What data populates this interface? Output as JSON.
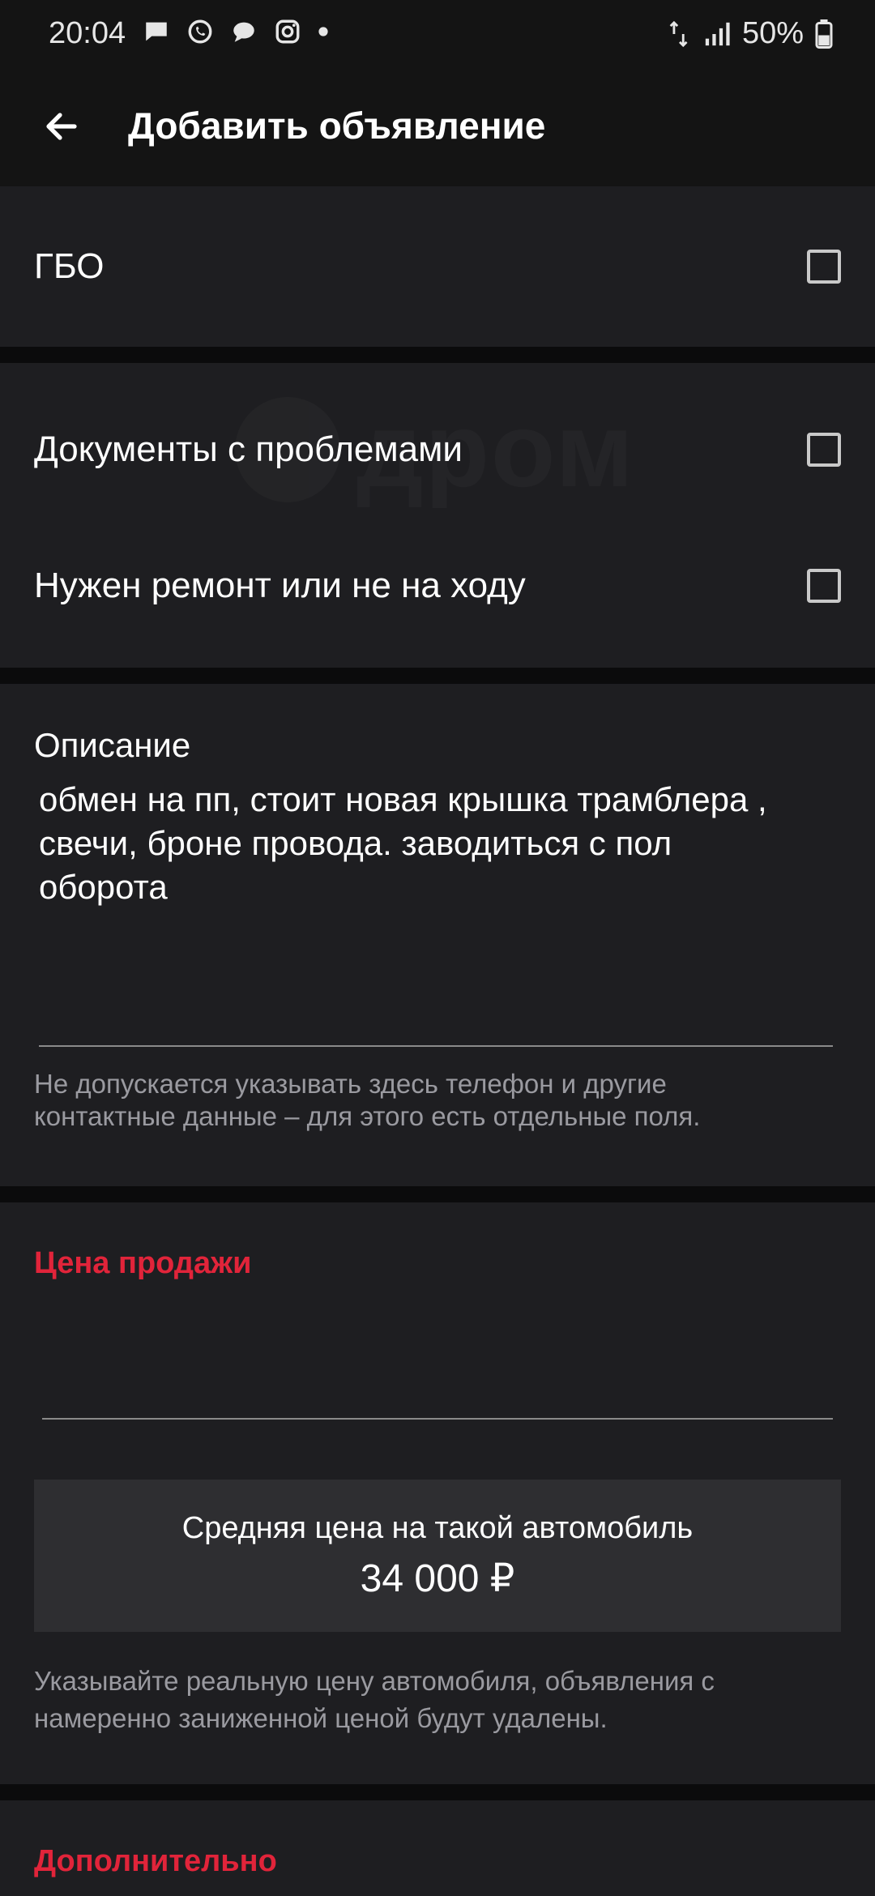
{
  "status_bar": {
    "time": "20:04",
    "battery_percent": "50%",
    "icons_left": [
      "message-icon",
      "whatsapp-icon",
      "chat-icon",
      "instagram-icon",
      "dot-icon"
    ],
    "icons_right": [
      "data-icon",
      "signal-icon",
      "battery-icon"
    ]
  },
  "app_bar": {
    "title": "Добавить объявление",
    "back_icon": "arrow-left-icon"
  },
  "options": {
    "gbo_label": "ГБО",
    "documents_label": "Документы с проблемами",
    "repair_label": "Нужен ремонт или не на ходу"
  },
  "watermark": {
    "text": "дром"
  },
  "description": {
    "label": "Описание",
    "value": "обмен на пп, стоит новая крышка трамблера , свечи, броне провода. заводиться с пол оборота",
    "hint": "Не допускается указывать здесь телефон и другие контактные данные – для этого есть отдельные поля."
  },
  "price": {
    "heading": "Цена продажи",
    "avg_label": "Средняя цена на такой автомобиль",
    "avg_value": "34 000 ₽",
    "hint": "Указывайте реальную цену автомобиля, объявления с намеренно заниженной ценой будут удалены."
  },
  "additional": {
    "heading": "Дополнительно"
  },
  "colors": {
    "accent_red": "#e1243a",
    "card_bg": "#1e1e21",
    "page_bg": "#0b0b0c"
  }
}
